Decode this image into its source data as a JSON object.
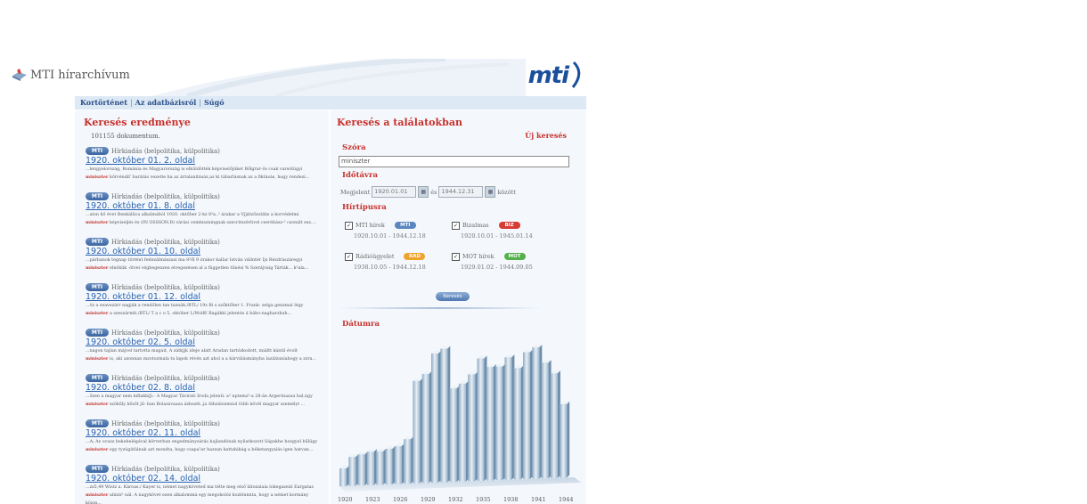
{
  "header": {
    "app_title": "MTI hírarchívum",
    "brand_logo": "mti"
  },
  "nav": {
    "items": [
      "Kortörténet",
      "Az adatbázisról",
      "Súgó"
    ],
    "separator": "|"
  },
  "results_panel": {
    "title": "Keresés eredménye",
    "doc_count": "101155 dokumentum.",
    "badge": "MTI",
    "source": "Hírkiadás (belpolitika, külpolitika)",
    "items": [
      {
        "title": "1920. október 01. 2. oldal",
        "before": "...lengyelország, Románia és Magyarország is elküldötték képviselőjüket Bőlgrar-ős csak varsótiigyi",
        "kw": "miniszter",
        "after": "kőrvéndil' barátás vezette ha az ártalanításáz,az ki tábarlásnak az a fiktásás, hogy rendezi..."
      },
      {
        "title": "1920. október 01. 8. oldal",
        "before": "...alon hő évet Benkállica alkalmából 1920. oktőber 2-kz 8²a..² árakar a Vjjátzőzoláhs a korvédelmi",
        "kw": "miniszter",
        "after": "képviseljés és (IN OSSSON.R) várási cembiszningnak szecritszértivel cserébász-² csonált esz...."
      },
      {
        "title": "1920. október 01. 10. oldal",
        "before": "...párbanok tegnap történt fedezálmászasi ma 8²ől 9 órakor kallar István vállntér Ijs Rézdrászáregyi",
        "kw": "miniszter",
        "after": "elnökük ·ötvei végbegenzen elvegezésen al a független tűnési % Szerájvaig Tárták... k²ala..."
      },
      {
        "title": "1920. október 01. 12. oldal",
        "before": "...öz a seavezárr nagják a rendőlen tan taznák./BTL/ 19s Bi s szőktőber 1. Frank- zelga genzmal légy",
        "kw": "miniszter",
        "after": "a szeszármlt./BTL/ T a c o 5, október L/Wolff/ Bagákki jelentés á hábo-nagharzhah..."
      },
      {
        "title": "1920. október 02. 5. oldal",
        "before": "...nagon tajlan májvel tartotta magait, A zátkjjk ideje alatt Aradan tartózkodott, miáltt kántil évolt",
        "kw": "miniszter",
        "after": "is, aki azonnan mzotozmala ta lapok révén azt ahol a a kárválásmányba lazálzaniabogy a zzra..."
      },
      {
        "title": "1920. október 02. 8. oldal",
        "before": "...őzen a magyar nem kiflakbiJi.- A Magyar Távirati Iroda jelenti: a² nptemz²-a 28-án Argerinazau bal,úgy",
        "kw": "miniszter",
        "after": "szökűly kőzőt jű- ban Bolaszvaaza ázbszét..ja Albzálozmúul több kövél magyar személyt ..."
      },
      {
        "title": "1920. október 02. 11. oldal",
        "before": "...A; Az ocusz bekebelégával körverban engedmánysárás hajlandónak nyilatkozott Sápakhe hozgyel bűlügy",
        "kw": "miniszter",
        "after": "egy tyzúgátlának azt mondta, hogy csapa²ar hazzan kattahikág a béketargyalás igen hatvan..."
      },
      {
        "title": "1920. október 02. 14. oldal",
        "before": "...zz5,49 Wistz a. Károas./ Kayer is, német nagyköveted ma tétte meg első látozalaia lokegazeát Eargatas",
        "kw": "miniszter",
        "after": "almín² nál. A nagykövet ezen alkalommá egy megokolóz kozlénnnta, hogy a német kormány közzs..."
      }
    ]
  },
  "search_panel": {
    "title": "Keresés a találatokban",
    "new_search": "Új keresés",
    "word_label": "Szóra",
    "word_value": "miniszter",
    "time_label": "Időtávra",
    "date_prefix": "Megjelent",
    "date_from": "1920.01.01",
    "date_mid": "és",
    "date_to": "1944.12.31",
    "date_suffix": "között",
    "type_label": "Hírtípusra",
    "types": [
      {
        "label": "MTI hírek",
        "pill": "MTI",
        "range": "1920.10.01 - 1944.12.18",
        "color": "#5b86bf"
      },
      {
        "label": "Bizalmas",
        "pill": "BIZ",
        "range": "1920.10.01 - 1945.01.14",
        "color": "#d63b35"
      },
      {
        "label": "Rádióügyelet",
        "pill": "RAD",
        "range": "1938.10.05 - 1944.12.18",
        "color": "#f0a22e"
      },
      {
        "label": "MOT hírek",
        "pill": "MOT",
        "range": "1929.01.02 - 1944.09.05",
        "color": "#53b04a"
      }
    ],
    "search_button": "Keresés",
    "by_date_label": "Dátumra"
  },
  "chart_data": {
    "type": "bar",
    "categories": [
      "1920",
      "1921",
      "1922",
      "1923",
      "1924",
      "1925",
      "1926",
      "1927",
      "1928",
      "1929",
      "1930",
      "1931",
      "1932",
      "1933",
      "1934",
      "1935",
      "1936",
      "1937",
      "1938",
      "1939",
      "1940",
      "1941",
      "1942",
      "1943",
      "1944"
    ],
    "values": [
      8,
      13,
      14,
      15,
      15,
      16,
      17,
      20,
      46,
      49,
      58,
      60,
      42,
      44,
      48,
      55,
      51,
      51,
      55,
      50,
      57,
      59,
      52,
      47,
      33
    ],
    "x_tick_labels": [
      "1920",
      "1923",
      "1926",
      "1929",
      "1932",
      "1935",
      "1938",
      "1941",
      "1944"
    ]
  }
}
